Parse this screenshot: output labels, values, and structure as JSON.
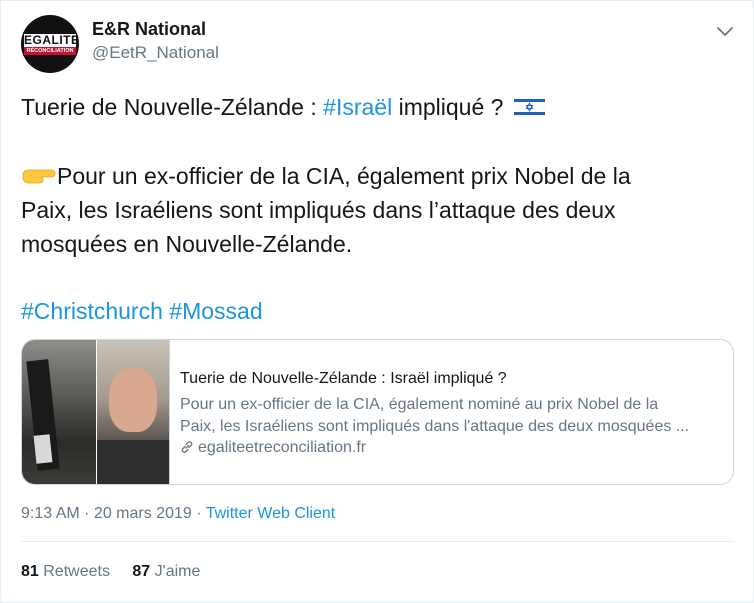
{
  "author": {
    "display_name": "E&R National",
    "handle": "@EetR_National",
    "avatar_logo_top": "EGALITE",
    "avatar_logo_bottom": "RÉCONCILIATION"
  },
  "tweet": {
    "line1_text": "Tuerie de Nouvelle-Zélande : ",
    "line1_hashtag": "#Israël",
    "line1_suffix": " impliqué ?",
    "flag_icon": "israel-flag",
    "pointing_icon": "pointing-right-emoji",
    "line2": "Pour un ex-officier de la CIA, également prix Nobel de la",
    "line3": "Paix, les Israéliens sont impliqués dans l’attaque des deux",
    "line4": "mosquées en Nouvelle-Zélande.",
    "hashtag1": "#Christchurch",
    "hashtag2": "#Mossad"
  },
  "card": {
    "title": "Tuerie de Nouvelle-Zélande : Israël impliqué ?",
    "desc_line1": "Pour un ex-officier de la CIA, également nominé au prix Nobel de la",
    "desc_line2": "Paix, les Israéliens sont impliqués dans l'attaque des deux mosquées ...",
    "domain": "egaliteetreconciliation.fr"
  },
  "meta": {
    "time": "9:13 AM",
    "separator": " · ",
    "date": "20 mars 2019",
    "client": "Twitter Web Client"
  },
  "stats": {
    "retweets_count": "81",
    "retweets_label": "Retweets",
    "likes_count": "87",
    "likes_label": "J'aime"
  },
  "colors": {
    "link": "#1b95e0",
    "secondary_text": "#657786",
    "primary_text": "#14171a"
  }
}
